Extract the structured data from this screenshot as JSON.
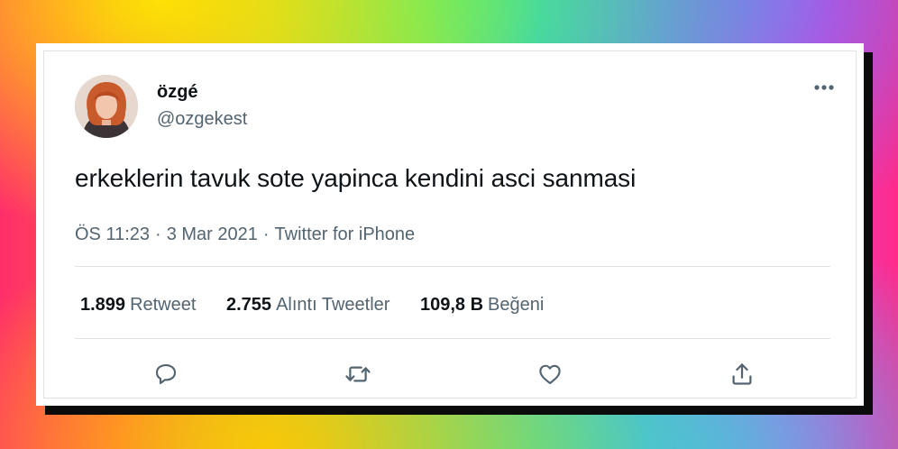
{
  "tweet": {
    "display_name": "özgé",
    "handle": "@ozgekest",
    "text": "erkeklerin tavuk sote yapinca kendini asci sanmasi",
    "time": "ÖS 11:23",
    "date": "3 Mar 2021",
    "source": "Twitter for iPhone",
    "separator": "·"
  },
  "stats": [
    {
      "value": "1.899",
      "label": "Retweet"
    },
    {
      "value": "2.755",
      "label": "Alıntı Tweetler"
    },
    {
      "value": "109,8 B",
      "label": "Beğeni"
    }
  ],
  "icons": {
    "more": "more-horizontal-icon",
    "reply": "reply-icon",
    "retweet": "retweet-icon",
    "like": "heart-icon",
    "share": "share-icon"
  },
  "colors": {
    "text_primary": "#0f1419",
    "text_secondary": "#536471",
    "divider": "#dfe3e6",
    "card": "#ffffff"
  }
}
